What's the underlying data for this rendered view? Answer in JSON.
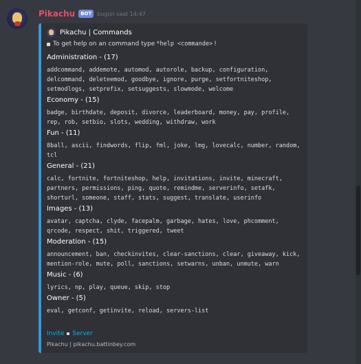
{
  "message": {
    "username": "Pikachu",
    "bot_badge": "BOT",
    "timestamp": "bugün saat 14:47"
  },
  "embed": {
    "accent_color": "#3498db",
    "author": "Pikachu | Commands",
    "description_prefix": "To get help on an command type",
    "description_code": "*help <commande>",
    "description_suffix": "!",
    "fields": [
      {
        "name": "Administration - (17)",
        "value": "addcommand, addemote, automod, autorole, backup, configuration, delcommand, deleteemod, goodbye, ignore, purge, setfortniteshop, setmodlogs, setprefix, setsuggests, slowmode, welcome"
      },
      {
        "name": "Economy - (15)",
        "value": "badge, birthdate, deposit, divorce, leaderboard, money, pay, profile, rep, rob, setbio, slots, wedding, withdraw, work"
      },
      {
        "name": "Fun - (11)",
        "value": "8ball, ascii, findwords, flip, fml, joke, lmg, lovecalc, number, random, tcl"
      },
      {
        "name": "General - (21)",
        "value": "calc, fortnite, fortniteshop, help, invitations, invite, minecraft, partners, permissions, ping, quote, remindme, serverinfo, setafk, shorturl, someone, staff, stats, suggest, translate, userinfo"
      },
      {
        "name": "Images - (13)",
        "value": "avatar, captcha, clyde, facepalm, garbage, hates, love, phcomment, qrcode, respect, shit, triggered, tweet"
      },
      {
        "name": "Moderation - (15)",
        "value": "announcement, ban, checkinvites, clear-sanctions, clear, giveaway, kick, mention-role, mute, poll, sanctions, setwarns, unban, unmute, warn"
      },
      {
        "name": "Music - (6)",
        "value": "lyrics, np, play, queue, skip, stop"
      },
      {
        "name": "Owner - (5)",
        "value": "eval, getconf, getinvite, reload, servers-list"
      }
    ],
    "links": {
      "invite": "Invite",
      "server": "Server"
    },
    "footer": "Pikachu | pikachu.battinbey.com"
  }
}
